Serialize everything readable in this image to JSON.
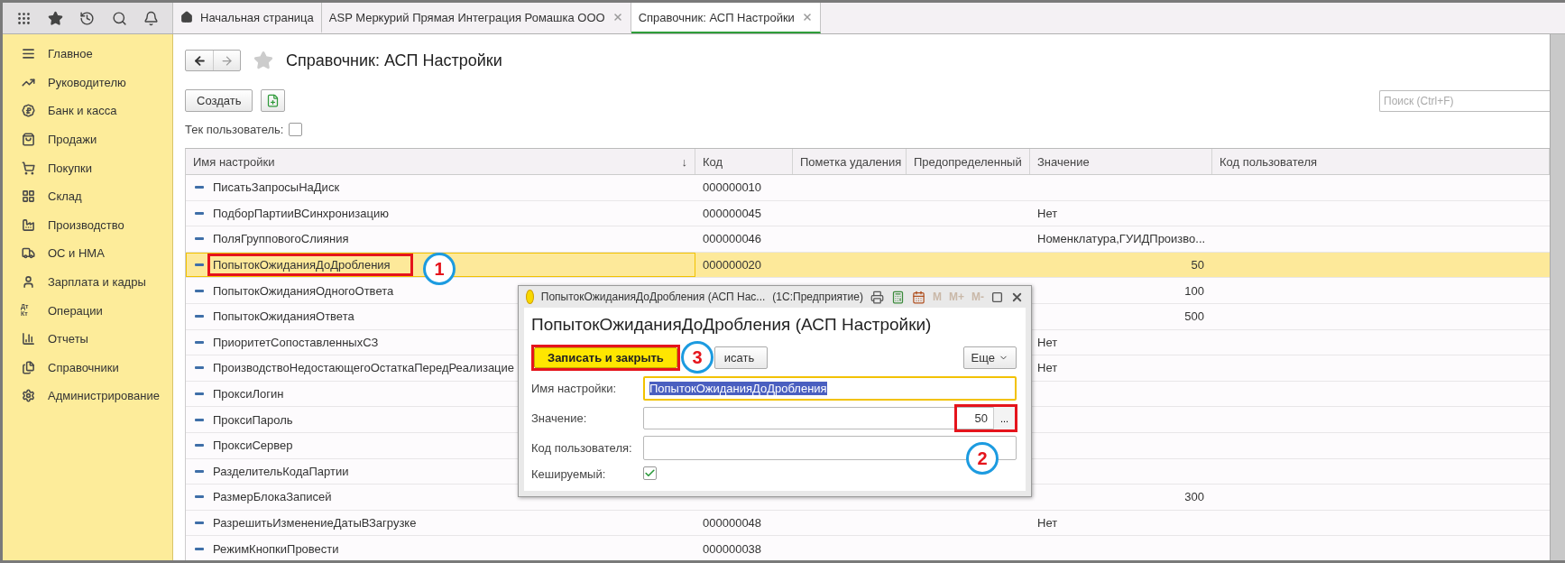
{
  "tabs": [
    {
      "kind": "home",
      "label": "Начальная страница",
      "selected": false
    },
    {
      "kind": "closable",
      "label": "ASP Меркурий Прямая Интеграция Ромашка ООО",
      "selected": false
    },
    {
      "kind": "closable",
      "label": "Справочник: АСП Настройки",
      "selected": true
    }
  ],
  "sidebar": {
    "items": [
      {
        "label": "Главное"
      },
      {
        "label": "Руководителю"
      },
      {
        "label": "Банк и касса"
      },
      {
        "label": "Продажи"
      },
      {
        "label": "Покупки"
      },
      {
        "label": "Склад"
      },
      {
        "label": "Производство"
      },
      {
        "label": "ОС и НМА"
      },
      {
        "label": "Зарплата и кадры"
      },
      {
        "label": "Операции",
        "icon_text": "Дт\nКт"
      },
      {
        "label": "Отчеты"
      },
      {
        "label": "Справочники"
      },
      {
        "label": "Администрирование"
      }
    ]
  },
  "page": {
    "title": "Справочник: АСП Настройки",
    "create_button": "Создать",
    "current_user": {
      "label": "Тек пользователь:",
      "checked": false
    },
    "search": {
      "placeholder": "Поиск (Ctrl+F)"
    }
  },
  "table": {
    "columns": [
      {
        "label": "Имя настройки",
        "sort_mark": "↓"
      },
      {
        "label": "Код"
      },
      {
        "label": "Пометка удаления"
      },
      {
        "label": "Предопределенный"
      },
      {
        "label": "Значение"
      },
      {
        "label": "Код пользователя"
      }
    ],
    "rows": [
      {
        "name": "ПисатьЗапросыНаДиск",
        "code": "000000010",
        "selected": false
      },
      {
        "name": "ПодборПартииВСинхронизацию",
        "code": "000000045",
        "value": "Нет",
        "kind": "text",
        "selected": false
      },
      {
        "name": "ПоляГрупповогоСлияния",
        "code": "000000046",
        "value": "Номенклатура,ГУИДПроизво...",
        "kind": "text",
        "selected": false
      },
      {
        "name": "ПопытокОжиданияДоДробления",
        "code": "000000020",
        "value": "50",
        "kind": "number",
        "selected": true
      },
      {
        "name": "ПопытокОжиданияОдногоОтвета",
        "value": "100",
        "kind": "number",
        "selected": false
      },
      {
        "name": "ПопытокОжиданияОтвета",
        "value": "500",
        "kind": "number",
        "selected": false
      },
      {
        "name": "ПриоритетСопоставленныхСЗ",
        "value": "Нет",
        "kind": "text",
        "selected": false
      },
      {
        "name": "ПроизводствоНедостающегоОстаткаПередРеализацие",
        "value": "Нет",
        "kind": "text",
        "selected": false
      },
      {
        "name": "ПроксиЛогин",
        "selected": false
      },
      {
        "name": "ПроксиПароль",
        "selected": false
      },
      {
        "name": "ПроксиСервер",
        "selected": false
      },
      {
        "name": "РазделительКодаПартии",
        "selected": false
      },
      {
        "name": "РазмерБлокаЗаписей",
        "value": "300",
        "kind": "number",
        "selected": false
      },
      {
        "name": "РазрешитьИзменениеДатыВЗагрузке",
        "code": "000000048",
        "value": "Нет",
        "kind": "text",
        "selected": false
      },
      {
        "name": "РежимКнопкиПровести",
        "code": "000000038",
        "selected": false
      }
    ]
  },
  "dialog": {
    "title": "ПопытокОжиданияДоДробления (АСП Нас...",
    "app": "(1С:Предприятие)",
    "memory_buttons": [
      {
        "label": "M",
        "disabled": true
      },
      {
        "label": "M+",
        "disabled": true
      },
      {
        "label": "M-",
        "disabled": true
      }
    ],
    "heading": "ПопытокОжиданияДоДробления (АСП Настройки)",
    "buttons": [
      {
        "kind": "default",
        "label": "Записать и закрыть"
      },
      {
        "kind": "plain",
        "label": "исать"
      },
      {
        "kind": "menu",
        "label": "Еще"
      }
    ],
    "fields": [
      {
        "kind": "text",
        "label": "Имя настройки:",
        "value": "ПопытокОжиданияДоДробления",
        "focused": true
      },
      {
        "kind": "choice",
        "label": "Значение:",
        "value": "50",
        "button": "..."
      },
      {
        "kind": "text",
        "label": "Код пользователя:"
      },
      {
        "kind": "checkbox",
        "label": "Кешируемый:",
        "checked": true
      }
    ]
  },
  "annotations": [
    {
      "kind": "row",
      "label": "1"
    },
    {
      "kind": "save",
      "label": "3"
    },
    {
      "kind": "value",
      "label": "2"
    }
  ]
}
